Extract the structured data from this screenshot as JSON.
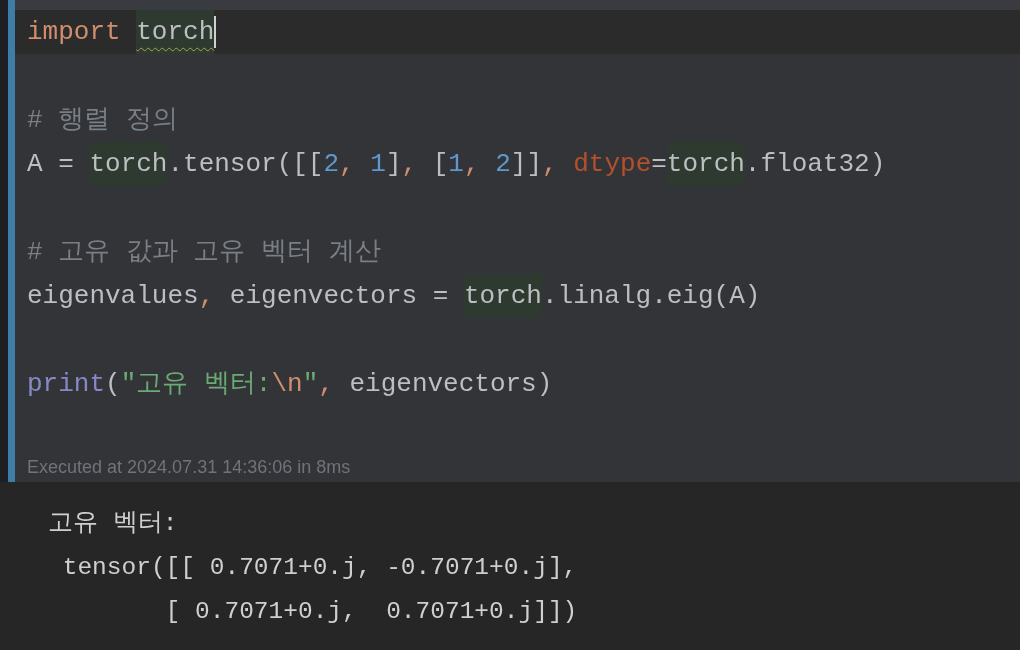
{
  "cell": {
    "lines": [
      {
        "current": true,
        "blank_before": false,
        "tokens": [
          {
            "kind": "keyword",
            "text": "import "
          },
          {
            "kind": "flagged",
            "text": "torch"
          }
        ]
      },
      {
        "current": false,
        "blank_before": true,
        "tokens": [
          {
            "kind": "comment",
            "text": "# 행렬 정의"
          }
        ]
      },
      {
        "current": false,
        "blank_before": false,
        "tokens": [
          {
            "kind": "plain",
            "text": "A = "
          },
          {
            "kind": "usage",
            "text": "torch"
          },
          {
            "kind": "plain",
            "text": ".tensor([["
          },
          {
            "kind": "number",
            "text": "2"
          },
          {
            "kind": "comma",
            "text": ", "
          },
          {
            "kind": "number",
            "text": "1"
          },
          {
            "kind": "plain",
            "text": "]"
          },
          {
            "kind": "comma",
            "text": ", "
          },
          {
            "kind": "plain",
            "text": "["
          },
          {
            "kind": "number",
            "text": "1"
          },
          {
            "kind": "comma",
            "text": ", "
          },
          {
            "kind": "number",
            "text": "2"
          },
          {
            "kind": "plain",
            "text": "]]"
          },
          {
            "kind": "comma",
            "text": ", "
          },
          {
            "kind": "param",
            "text": "dtype"
          },
          {
            "kind": "plain",
            "text": "="
          },
          {
            "kind": "usage",
            "text": "torch"
          },
          {
            "kind": "plain",
            "text": ".float32)"
          }
        ]
      },
      {
        "current": false,
        "blank_before": true,
        "tokens": [
          {
            "kind": "comment",
            "text": "# 고유 값과 고유 벡터 계산"
          }
        ]
      },
      {
        "current": false,
        "blank_before": false,
        "tokens": [
          {
            "kind": "plain",
            "text": "eigenvalues"
          },
          {
            "kind": "comma",
            "text": ", "
          },
          {
            "kind": "plain",
            "text": "eigenvectors = "
          },
          {
            "kind": "usage",
            "text": "torch"
          },
          {
            "kind": "plain",
            "text": ".linalg.eig(A)"
          }
        ]
      },
      {
        "current": false,
        "blank_before": true,
        "tokens": [
          {
            "kind": "builtin",
            "text": "print"
          },
          {
            "kind": "plain",
            "text": "("
          },
          {
            "kind": "string",
            "text": "\"고유 벡터:"
          },
          {
            "kind": "escape",
            "text": "\\n"
          },
          {
            "kind": "string",
            "text": "\""
          },
          {
            "kind": "comma",
            "text": ", "
          },
          {
            "kind": "plain",
            "text": "eigenvectors)"
          }
        ]
      }
    ],
    "execution_info": "Executed at 2024.07.31 14:36:06 in 8ms"
  },
  "output": {
    "lines": [
      "고유 벡터:",
      " tensor([[ 0.7071+0.j, -0.7071+0.j],",
      "        [ 0.7071+0.j,  0.7071+0.j]])"
    ]
  }
}
